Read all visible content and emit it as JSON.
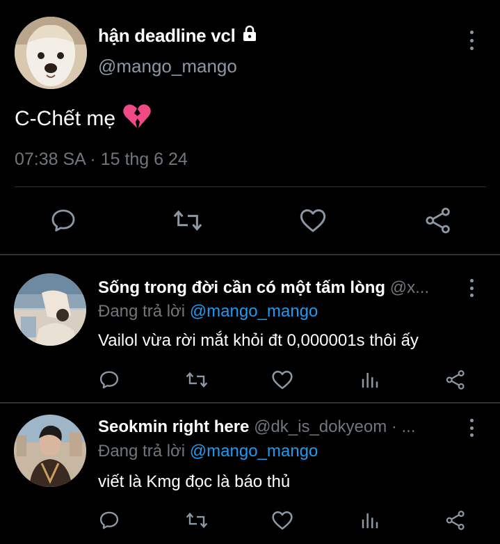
{
  "main_tweet": {
    "author_name": "hận deadline vcl",
    "handle": "@mango_mango",
    "text": "C-Chết mẹ",
    "emoji": "💔",
    "timestamp": "07:38 SA · 15 thg 6 24",
    "lock_icon": "lock-icon"
  },
  "replies": [
    {
      "name": "Sống trong đời cần có một tấm lòng",
      "handle": "@x...",
      "replying_prefix": "Đang trả lời",
      "replying_to": "@mango_mango",
      "text": "Vailol vừa rời mắt khỏi đt 0,000001s thôi ấy"
    },
    {
      "name": "Seokmin right here",
      "handle": "@dk_is_dokyeom · ...",
      "replying_prefix": "Đang trả lời",
      "replying_to": "@mango_mango",
      "text": "viết là Kmg đọc là báo thủ"
    }
  ],
  "colors": {
    "background": "#000000",
    "text": "#ffffff",
    "secondary": "#71767b",
    "link": "#1d9bf0",
    "divider": "#2f3336",
    "icon": "#8b98a5",
    "heart_broken": "#f04a86"
  }
}
